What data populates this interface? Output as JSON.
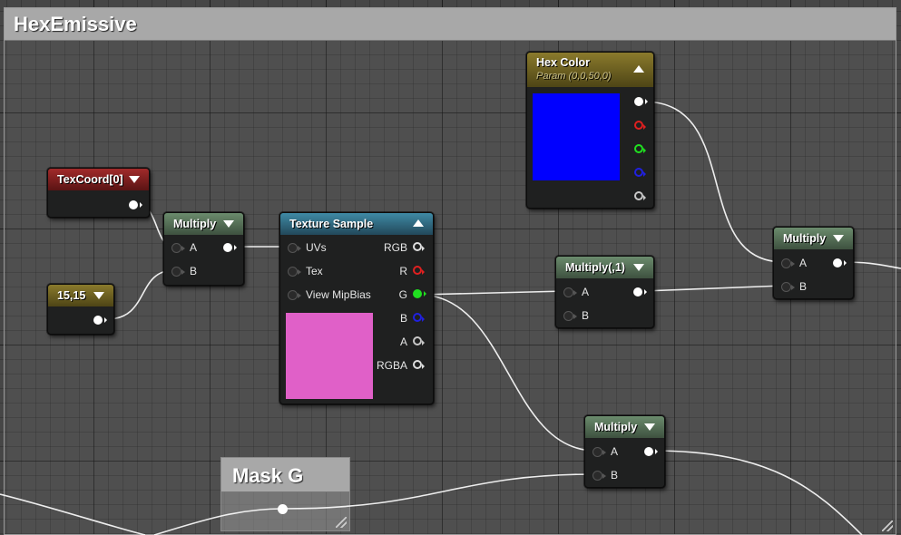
{
  "comments": {
    "hex_emissive": "HexEmissive",
    "mask_g": "Mask G"
  },
  "nodes": {
    "texcoord": {
      "title": "TexCoord[0]"
    },
    "const_15": {
      "title": "15,15"
    },
    "multiply_uv": {
      "title": "Multiply",
      "pins": [
        "A",
        "B"
      ]
    },
    "texture_sample": {
      "title": "Texture Sample",
      "inputs": [
        "UVs",
        "Tex",
        "View MipBias"
      ],
      "outputs": [
        "RGB",
        "R",
        "G",
        "B",
        "A",
        "RGBA"
      ],
      "preview_color": "#e060c8"
    },
    "hex_color": {
      "title": "Hex Color",
      "subtitle": "Param (0,0,50,0)",
      "preview_color": "#0000ff"
    },
    "multiply_1": {
      "title": "Multiply(,1)",
      "pins": [
        "A",
        "B"
      ]
    },
    "multiply_right": {
      "title": "Multiply",
      "pins": [
        "A",
        "B"
      ]
    },
    "multiply_bottom": {
      "title": "Multiply",
      "pins": [
        "A",
        "B"
      ]
    }
  },
  "colors": {
    "graph_bg": "#464646",
    "wire": "#ffffff",
    "pin_red": "#e02020",
    "pin_green": "#20e020",
    "pin_blue": "#2020e0",
    "pin_alpha": "#c8c8c8"
  }
}
